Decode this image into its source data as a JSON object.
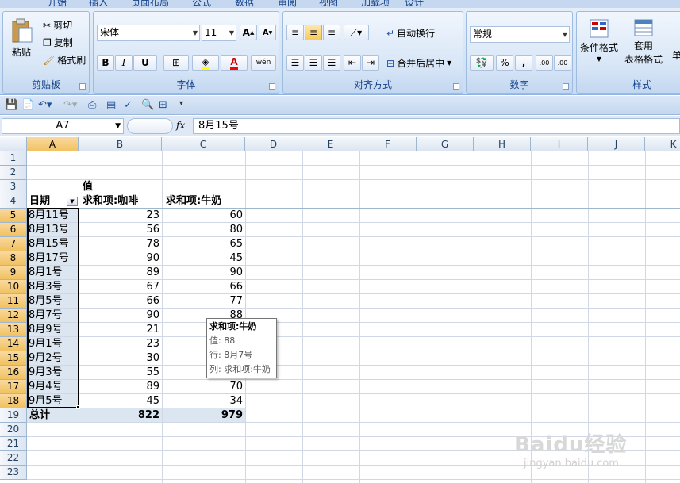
{
  "ribbon": {
    "tabs": [
      "开始",
      "插入",
      "页面布局",
      "公式",
      "数据",
      "审阅",
      "视图",
      "加载项",
      "设计"
    ],
    "clipboard": {
      "paste": "粘贴",
      "cut": "剪切",
      "copy": "复制",
      "format_painter": "格式刷",
      "label": "剪贴板"
    },
    "font": {
      "name": "宋体",
      "size": "11",
      "bold": "B",
      "italic": "I",
      "underline": "U",
      "grow": "A",
      "shrink": "A",
      "wen": "wén",
      "label": "字体"
    },
    "alignment": {
      "wrap": "自动换行",
      "merge": "合并后居中",
      "label": "对齐方式"
    },
    "number": {
      "format": "常规",
      "percent": "%",
      "comma": ",",
      "inc_decimal": ".00",
      "dec_decimal": ".00",
      "label": "数字"
    },
    "styles": {
      "conditional": "条件格式",
      "table_format_1": "套用",
      "table_format_2": "表格格式",
      "cell_styles": "单",
      "label": "样式"
    }
  },
  "formula_bar": {
    "name_box": "A7",
    "fx": "fx",
    "value": "8月15号"
  },
  "columns": [
    "A",
    "B",
    "C",
    "D",
    "E",
    "F",
    "G",
    "H",
    "I",
    "J",
    "K"
  ],
  "rows": [
    "1",
    "2",
    "3",
    "4",
    "5",
    "6",
    "7",
    "8",
    "9",
    "10",
    "11",
    "12",
    "13",
    "14",
    "15",
    "16",
    "17",
    "18",
    "19",
    "20",
    "21",
    "22",
    "23"
  ],
  "pivot": {
    "values_header": "值",
    "row_label": "日期",
    "col_coffee": "求和项:咖啡",
    "col_milk": "求和项:牛奶",
    "data": [
      {
        "date": "8月11号",
        "coffee": "23",
        "milk": "60"
      },
      {
        "date": "8月13号",
        "coffee": "56",
        "milk": "80"
      },
      {
        "date": "8月15号",
        "coffee": "78",
        "milk": "65"
      },
      {
        "date": "8月17号",
        "coffee": "90",
        "milk": "45"
      },
      {
        "date": "8月1号",
        "coffee": "89",
        "milk": "90"
      },
      {
        "date": "8月3号",
        "coffee": "67",
        "milk": "66"
      },
      {
        "date": "8月5号",
        "coffee": "66",
        "milk": "77"
      },
      {
        "date": "8月7号",
        "coffee": "90",
        "milk": "88"
      },
      {
        "date": "8月9号",
        "coffee": "21",
        "milk": ""
      },
      {
        "date": "9月1号",
        "coffee": "23",
        "milk": ""
      },
      {
        "date": "9月2号",
        "coffee": "30",
        "milk": ""
      },
      {
        "date": "9月3号",
        "coffee": "55",
        "milk": ""
      },
      {
        "date": "9月4号",
        "coffee": "89",
        "milk": "70"
      },
      {
        "date": "9月5号",
        "coffee": "45",
        "milk": "34"
      }
    ],
    "total_label": "总计",
    "total_coffee": "822",
    "total_milk": "979"
  },
  "tooltip": {
    "title": "求和项:牛奶",
    "value": "值: 88",
    "row": "行: 8月7号",
    "column": "列: 求和项:牛奶"
  },
  "watermark": {
    "main": "Baidu经验",
    "sub": "jingyan.baidu.com"
  },
  "colors": {
    "ribbon": "#c8dcf1",
    "selection_header": "#f1c15f",
    "pivot_fill": "#dce6f1"
  }
}
